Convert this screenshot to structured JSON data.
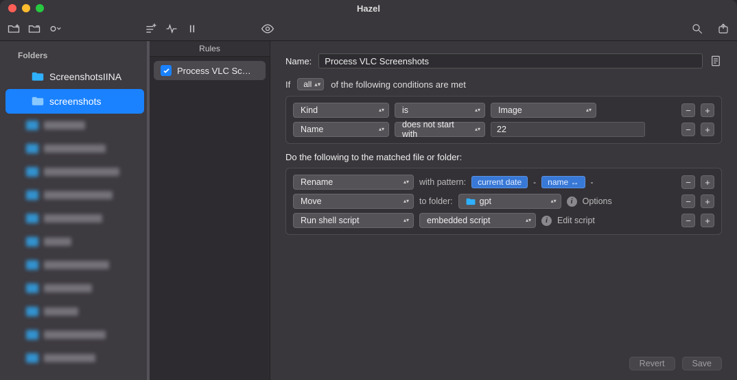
{
  "window": {
    "title": "Hazel"
  },
  "toolbar": {},
  "sidebar": {
    "header": "Folders",
    "items": [
      {
        "label": "ScreenshotsIINA"
      },
      {
        "label": "screenshots"
      }
    ],
    "blurred_count": 10
  },
  "rules": {
    "header": "Rules",
    "items": [
      {
        "checked": true,
        "label": "Process VLC Sc…"
      }
    ]
  },
  "editor": {
    "name_label": "Name:",
    "name_value": "Process VLC Screenshots",
    "if_prefix": "If",
    "match_scope": "all",
    "if_suffix": "of the following conditions are met",
    "conditions": [
      {
        "attr": "Kind",
        "op": "is",
        "val_select": "Image",
        "val_text": null
      },
      {
        "attr": "Name",
        "op": "does not start with",
        "val_select": null,
        "val_text": "22"
      }
    ],
    "actions_header": "Do the following to the matched file or folder:",
    "actions": [
      {
        "type": "Rename",
        "mid_label": "with pattern:",
        "tokens": [
          "current date",
          "-",
          "name ↔"
        ],
        "trailing_sep": "-"
      },
      {
        "type": "Move",
        "mid_label": "to folder:",
        "folder": "gpt",
        "aux": "Options"
      },
      {
        "type": "Run shell script",
        "script_sel": "embedded script",
        "aux": "Edit script"
      }
    ],
    "buttons": {
      "revert": "Revert",
      "save": "Save"
    }
  }
}
